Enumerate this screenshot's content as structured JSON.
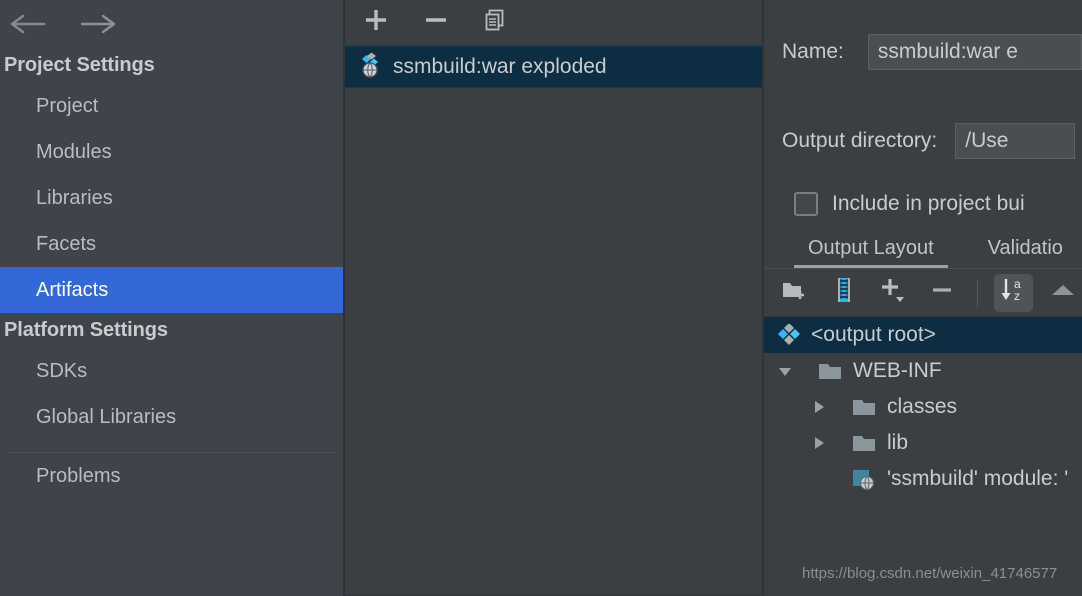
{
  "sidebar": {
    "nav": {
      "back_icon": "arrow-left-icon",
      "forward_icon": "arrow-right-icon"
    },
    "groups": [
      {
        "title": "Project Settings",
        "items": [
          {
            "label": "Project",
            "selected": false
          },
          {
            "label": "Modules",
            "selected": false
          },
          {
            "label": "Libraries",
            "selected": false
          },
          {
            "label": "Facets",
            "selected": false
          },
          {
            "label": "Artifacts",
            "selected": true
          }
        ]
      },
      {
        "title": "Platform Settings",
        "items": [
          {
            "label": "SDKs",
            "selected": false
          },
          {
            "label": "Global Libraries",
            "selected": false
          }
        ]
      }
    ],
    "footer_items": [
      {
        "label": "Problems",
        "selected": false
      }
    ],
    "selection_color": "#3369d6"
  },
  "middle_panel": {
    "toolbar": [
      {
        "name": "add-artifact-button",
        "icon": "plus-icon",
        "label": "+"
      },
      {
        "name": "remove-artifact-button",
        "icon": "minus-icon",
        "label": "−"
      },
      {
        "name": "copy-artifact-button",
        "icon": "copy-icon",
        "label": ""
      }
    ],
    "artifacts": [
      {
        "label": "ssmbuild:war exploded",
        "icon": "artifact-web-icon",
        "selected": true
      }
    ],
    "selection_color": "#0d2d43"
  },
  "right_panel": {
    "name_label": "Name:",
    "name_value": "ssmbuild:war e",
    "output_dir_label": "Output directory:",
    "output_dir_value": "/Use",
    "include_checkbox": {
      "label": "Include in project bui",
      "checked": false
    },
    "tabs": [
      {
        "label": "Output Layout",
        "active": true
      },
      {
        "label": "Validatio",
        "active": false
      }
    ],
    "layout_toolbar": [
      {
        "name": "create-directory-button",
        "icon": "new-folder-icon"
      },
      {
        "name": "create-archive-button",
        "icon": "archive-icon"
      },
      {
        "name": "add-element-button",
        "icon": "plus-dropdown-icon"
      },
      {
        "name": "remove-element-button",
        "icon": "minus-icon"
      },
      {
        "name": "sort-alphabetically-button",
        "icon": "sort-az-icon",
        "pressed": true
      },
      {
        "name": "move-up-button",
        "icon": "triangle-up-icon"
      }
    ],
    "tree": [
      {
        "label": "<output root>",
        "icon": "artifact-root-icon",
        "indent": 0,
        "expander": "none",
        "selected": true
      },
      {
        "label": "WEB-INF",
        "icon": "folder-icon",
        "indent": 1,
        "expander": "expanded",
        "selected": false
      },
      {
        "label": "classes",
        "icon": "folder-icon",
        "indent": 2,
        "expander": "collapsed",
        "selected": false
      },
      {
        "label": "lib",
        "icon": "folder-icon",
        "indent": 2,
        "expander": "collapsed",
        "selected": false
      },
      {
        "label": "'ssmbuild' module: '",
        "icon": "module-web-icon",
        "indent": 2,
        "expander": "none",
        "selected": false
      }
    ],
    "watermark": "https://blog.csdn.net/weixin_41746577"
  }
}
